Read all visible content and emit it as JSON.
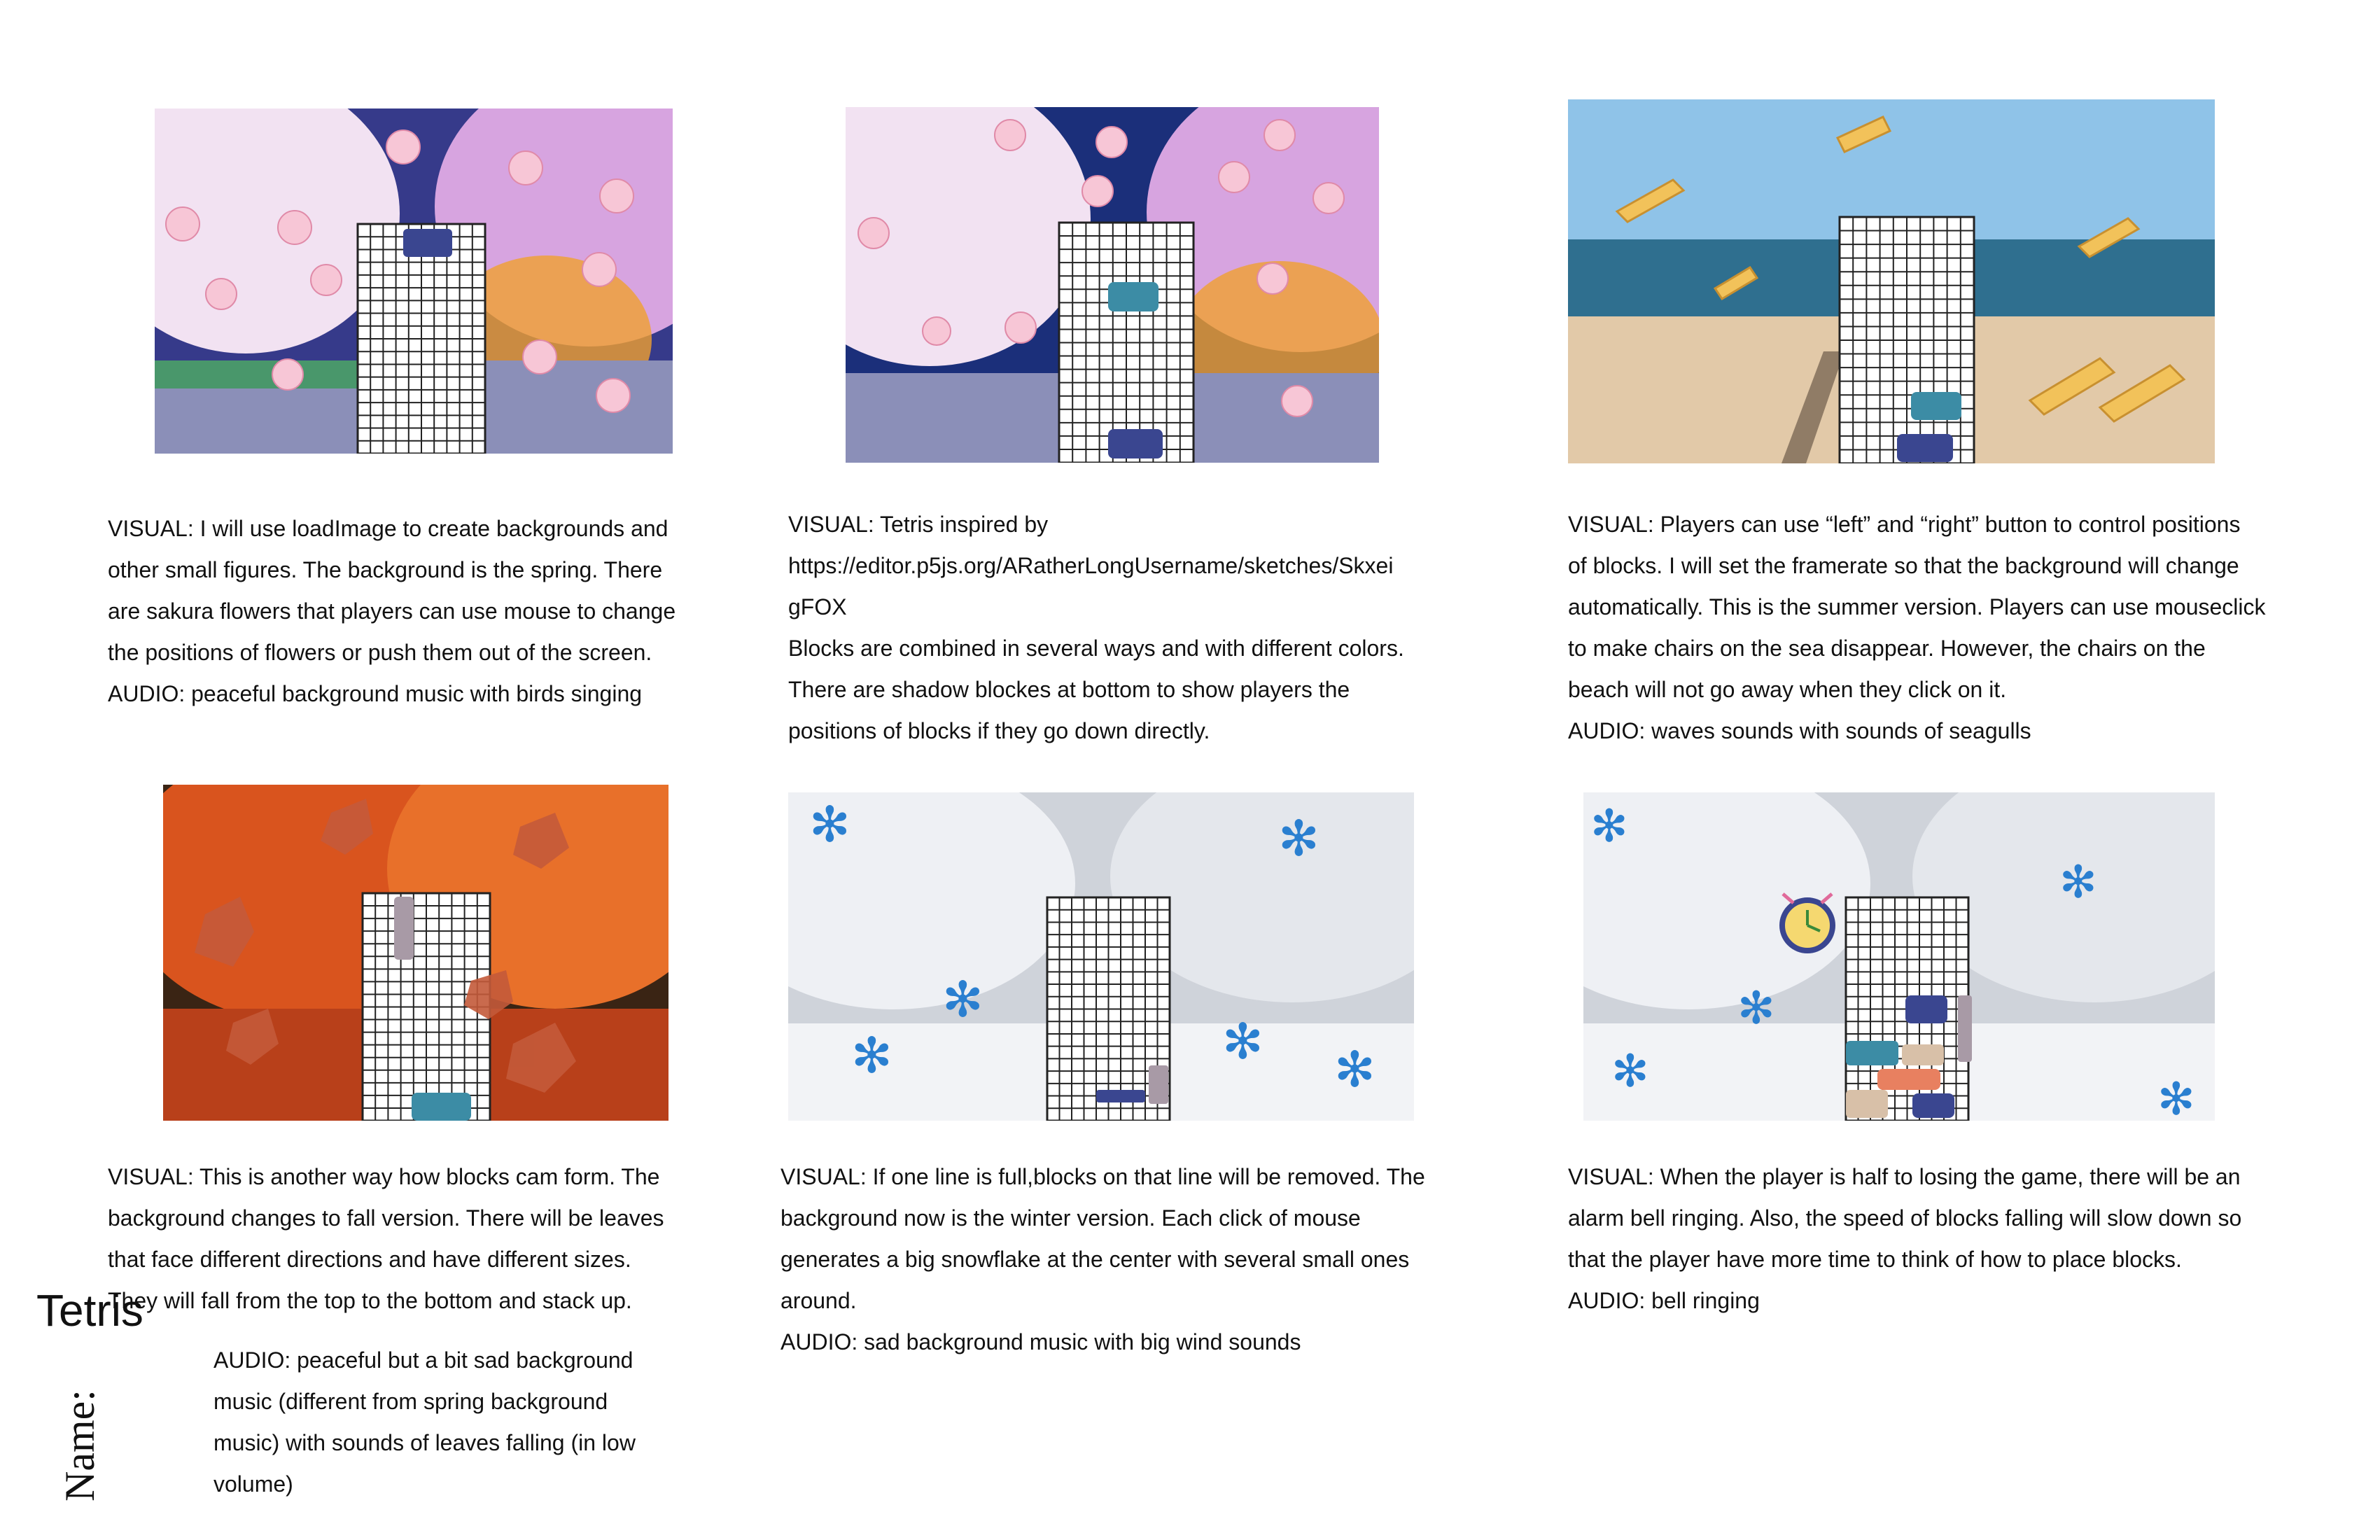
{
  "document": {
    "title": "Tetris",
    "name_label": "Name:"
  },
  "panels": [
    {
      "id": "spring",
      "season": "spring",
      "icons": [
        "sakura-flower-icon"
      ],
      "colors": {
        "sky": "#1b2f7a",
        "tree": "#e8b8e8",
        "path": "#8b8fb8",
        "block": "#3a4690"
      },
      "caption": [
        "VISUAL: I will use loadImage to create backgrounds and",
        "other small figures. The background is the spring. There",
        "are sakura flowers that players can use mouse to change",
        "the positions of flowers or push them out of the screen.",
        "AUDIO: peaceful background music with birds singing"
      ]
    },
    {
      "id": "spring-shadow",
      "season": "spring",
      "icons": [
        "sakura-flower-icon"
      ],
      "colors": {
        "sky": "#1b2f7a",
        "tree": "#e8b8e8",
        "block": "#3c8ca5",
        "shadow": "#3a4690"
      },
      "caption": [
        "VISUAL: Tetris inspired by",
        "https://editor.p5js.org/ARatherLongUsername/sketches/Skxei",
        "gFOX",
        "Blocks are combined in several ways and with different colors.",
        "There are shadow blockes at bottom to show players the",
        "positions of blocks if they go down directly."
      ]
    },
    {
      "id": "summer",
      "season": "summer",
      "icons": [
        "beach-chair-icon"
      ],
      "colors": {
        "sky": "#8fc3e8",
        "sea": "#2f6f8f",
        "sand": "#e2c9a8",
        "block": "#3c8ca5",
        "shadow": "#3a4690"
      },
      "caption": [
        "VISUAL: Players can use “left” and “right” button to control positions",
        "of blocks. I will set the framerate so that the background will change",
        "automatically. This is the summer version. Players can use mouseclick",
        "to make chairs on the sea disappear. However, the chairs on the",
        "beach will not go away when they click on it.",
        "AUDIO: waves sounds with sounds of seagulls"
      ]
    },
    {
      "id": "fall",
      "season": "fall",
      "icons": [
        "maple-leaf-icon"
      ],
      "colors": {
        "tree": "#d9541e",
        "ground": "#b8401a",
        "leaf": "#c45a3a",
        "block": "#3c8ca5",
        "accent": "#a89aa6"
      },
      "caption": [
        "VISUAL: This is another way how blocks cam form. The",
        "background changes to fall version. There will be leaves",
        "that face different directions and have different sizes.",
        "They will fall from the top to the bottom and stack up."
      ],
      "audio": [
        "AUDIO: peaceful but a bit sad background",
        "music (different from spring background",
        "music)  with sounds of leaves falling (in low",
        "volume)"
      ]
    },
    {
      "id": "winter",
      "season": "winter",
      "icons": [
        "snowflake-icon"
      ],
      "colors": {
        "snow": "#e8eaee",
        "trunk": "#4a4a4a",
        "flake": "#2a7fd0",
        "block": "#3a4690",
        "accent": "#a89aa6"
      },
      "caption": [
        "VISUAL: If one line is full,blocks on that line will be removed. The",
        "background now is the winter version. Each click of mouse",
        "generates a big snowflake at the center with several small ones",
        "around.",
        "AUDIO: sad background music with big wind sounds"
      ]
    },
    {
      "id": "winter-alarm",
      "season": "winter",
      "icons": [
        "snowflake-icon",
        "alarm-bell-icon"
      ],
      "colors": {
        "snow": "#e8eaee",
        "trunk": "#4a4a4a",
        "flake": "#2a7fd0",
        "block": "#3a4690",
        "stack1": "#3c8ca5",
        "stack2": "#e88060",
        "stack3": "#d8c0a8"
      },
      "caption": [
        "VISUAL: When the player is half to losing the game, there will be an",
        "alarm bell ringing. Also, the speed of blocks falling will slow down so",
        "that the player have more time to think of how to place blocks.",
        "AUDIO: bell ringing"
      ]
    }
  ]
}
